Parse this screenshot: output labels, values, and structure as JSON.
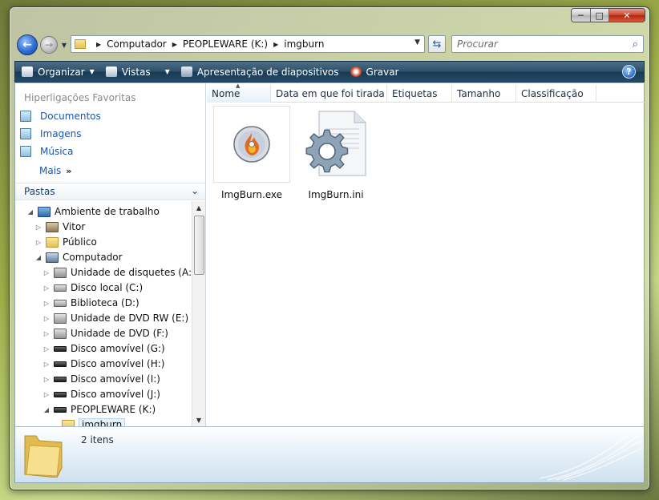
{
  "window": {
    "caption_min": "─",
    "caption_max": "□",
    "caption_close": "✕"
  },
  "address_bar": {
    "crumbs": [
      "Computador",
      "PEOPLEWARE (K:)",
      "imgburn"
    ],
    "search_placeholder": "Procurar"
  },
  "toolbar": {
    "organize": "Organizar",
    "views": "Vistas",
    "slideshow": "Apresentação de diapositivos",
    "burn": "Gravar",
    "help": "?"
  },
  "nav_pane": {
    "favorites_title": "Hiperligações Favoritas",
    "favorites": [
      "Documentos",
      "Imagens",
      "Música"
    ],
    "more": "Mais",
    "more_chevron": "»",
    "folders_title": "Pastas",
    "tree": [
      {
        "label": "Ambiente de trabalho",
        "icon": "desktop-icon",
        "level": 0,
        "expander": "◢"
      },
      {
        "label": "Vitor",
        "icon": "user-folder-icon",
        "level": 1,
        "expander": "▷"
      },
      {
        "label": "Público",
        "icon": "folder-icon",
        "level": 1,
        "expander": "▷"
      },
      {
        "label": "Computador",
        "icon": "computer-icon",
        "level": 1,
        "expander": "◢"
      },
      {
        "label": "Unidade de disquetes (A:)",
        "icon": "floppy-drive-icon",
        "level": 2,
        "expander": "▷"
      },
      {
        "label": "Disco local (C:)",
        "icon": "hard-drive-icon",
        "level": 2,
        "expander": "▷"
      },
      {
        "label": "Biblioteca (D:)",
        "icon": "hard-drive-icon",
        "level": 2,
        "expander": "▷"
      },
      {
        "label": "Unidade de DVD RW (E:)",
        "icon": "dvd-drive-icon",
        "level": 2,
        "expander": "▷"
      },
      {
        "label": "Unidade de DVD (F:)",
        "icon": "dvd-drive-icon",
        "level": 2,
        "expander": "▷"
      },
      {
        "label": "Disco amovível (G:)",
        "icon": "removable-drive-icon",
        "level": 2,
        "expander": "▷"
      },
      {
        "label": "Disco amovível (H:)",
        "icon": "removable-drive-icon",
        "level": 2,
        "expander": "▷"
      },
      {
        "label": "Disco amovível (I:)",
        "icon": "removable-drive-icon",
        "level": 2,
        "expander": "▷"
      },
      {
        "label": "Disco amovível (J:)",
        "icon": "removable-drive-icon",
        "level": 2,
        "expander": "▷"
      },
      {
        "label": "PEOPLEWARE (K:)",
        "icon": "removable-drive-icon",
        "level": 2,
        "expander": "◢"
      },
      {
        "label": "imgburn",
        "icon": "folder-icon",
        "level": 3,
        "expander": "",
        "selected": true
      }
    ]
  },
  "content": {
    "columns": [
      "Nome",
      "Data em que foi tirada",
      "Etiquetas",
      "Tamanho",
      "Classificação"
    ],
    "sorted_column": "Nome",
    "files": [
      {
        "name": "ImgBurn.exe",
        "icon": "imgburn-app-icon"
      },
      {
        "name": "ImgBurn.ini",
        "icon": "config-file-gear-icon"
      }
    ]
  },
  "details_pane": {
    "item_count": "2 itens",
    "icon": "folder-icon"
  },
  "colors": {
    "toolbar": "#264b68",
    "link": "#1a56a8",
    "folder": "#e6c35c"
  }
}
